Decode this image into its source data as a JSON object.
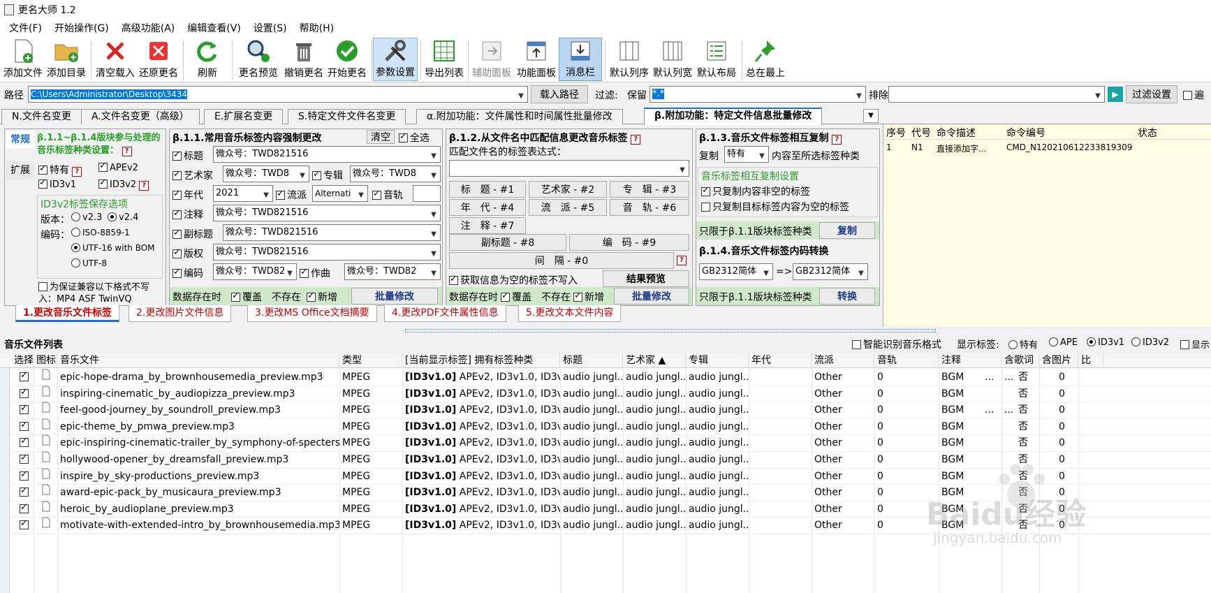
{
  "app": {
    "title": "更名大师 1.2"
  },
  "menu": [
    "文件(F)",
    "开始操作(G)",
    "高级功能(A)",
    "编辑查看(V)",
    "设置(S)",
    "帮助(H)"
  ],
  "toolbar": [
    "添加文件",
    "添加目录",
    "清空载入",
    "还原更名",
    "刷新",
    "更名预览",
    "撤销更名",
    "开始更名",
    "参数设置",
    "导出列表",
    "辅助面板",
    "功能面板",
    "消息栏",
    "默认列序",
    "默认列宽",
    "默认布局",
    "总在最上"
  ],
  "path": {
    "label": "路径",
    "value": "C:\\Users\\Administrator\\Desktop\\3434",
    "load_btn": "载入路径",
    "filter_label": "过滤:",
    "filter_keep": "保留",
    "filter_value": "*.*",
    "exclude_label": "排除",
    "filter_settings": "过滤设置",
    "edge": "遍"
  },
  "tabs": [
    "N.文件名变更",
    "A.文件名变更（高级）",
    "E.扩展名变更",
    "S.特定文件文件名变更",
    "α.附加功能：文件属性和时间属性批量修改",
    "β.附加功能：特定文件信息批量修改"
  ],
  "left": {
    "side_tab1": "常规",
    "side_tab2": "扩展",
    "title": "β.1.1~β.1.4版块参与处理的音乐标签种类设置：",
    "tags": [
      "特有",
      "APEv2",
      "ID3v1",
      "ID3v2"
    ],
    "id3v2_title": "ID3v2标签保存选项",
    "version_label": "版本：",
    "v23": "v2.3",
    "v24": "v2.4",
    "encoding_label": "编码：",
    "enc1": "ISO-8859-1",
    "enc2": "UTF-16 with BOM",
    "enc3": "UTF-8",
    "compat": "为保证兼容以下格式不写入：MP4 ASF TwinVQ"
  },
  "b11": {
    "title": "β.1.1.常用音乐标签内容强制更改",
    "clear": "清空",
    "select_all": "全选",
    "title_lbl": "标题",
    "title_val": "微众号：TWD821516",
    "artist_lbl": "艺术家",
    "artist_val": "微众号：TWD8",
    "album_lbl": "专辑",
    "album_val": "微众号：TWD8",
    "year_lbl": "年代",
    "year_val": "2021",
    "genre_lbl": "流派",
    "genre_val": "Alternati",
    "track_lbl": "音轨",
    "comment_lbl": "注释",
    "comment_val": "微众号：TWD821516",
    "subtitle_lbl": "副标题",
    "subtitle_val": "微众号：TWD821516",
    "copyright_lbl": "版权",
    "copyright_val": "微众号：TWD821516",
    "encoder_lbl": "编码",
    "encoder_val": "微众号：TWD82",
    "composer_lbl": "作曲",
    "composer_val": "微众号：TWD82",
    "exist_lbl": "数据存在时",
    "overwrite": "覆盖",
    "notexist": "不存在",
    "add": "新增",
    "batch": "批量修改"
  },
  "b12": {
    "title": "β.1.2.从文件名中匹配信息更改音乐标签",
    "expr_label": "匹配文件名的标签表达式：",
    "buttons": [
      "标　题 - #1",
      "艺术家 - #2",
      "专　辑 - #3",
      "年　代 - #4",
      "流　派 - #5",
      "音　轨 - #6",
      "注　释 - #7",
      "副标题 - #8",
      "编　码 - #9",
      "间　隔 - #0"
    ],
    "skip_empty": "获取信息为空的标签不写入",
    "preview": "结果预览",
    "exist_lbl": "数据存在时",
    "overwrite": "覆盖",
    "notexist": "不存在",
    "add": "新增",
    "batch": "批量修改"
  },
  "b13": {
    "title": "β.1.3.音乐文件标签相互复制",
    "copy_lbl": "复制",
    "copy_src": "特有",
    "copy_to": "内容至所选标签种类",
    "sub_title": "音乐标签相互复制设置",
    "opt1": "只复制内容非空的标签",
    "opt2": "只复制目标标签内容为空的标签",
    "limit": "只限于β.1.1版块标签种类",
    "copy_btn": "复制"
  },
  "b14": {
    "title": "β.1.4.音乐文件标签内码转换",
    "from": "GB2312简体",
    "arrow": "=>",
    "to": "GB2312简体",
    "limit": "只限于β.1.1版块标签种类",
    "convert_btn": "转换"
  },
  "cmd": {
    "headers": [
      "序号",
      "代号",
      "命令描述",
      "命令编号",
      "状态"
    ],
    "row": [
      "1",
      "N1",
      "直接添加字...",
      "CMD_N120210612233819309",
      ""
    ]
  },
  "bottom_tabs": [
    "1.更改音乐文件标签",
    "2.更改图片文件信息",
    "3.更改MS Office文档摘要",
    "4.更改PDF文件属性信息",
    "5.更改文本文件内容"
  ],
  "list": {
    "title": "音乐文件列表",
    "smart": "智能识别音乐格式",
    "show_label": "显示标签:",
    "show_opts": [
      "特有",
      "APE",
      "ID3v1",
      "ID3v2",
      "显示"
    ],
    "headers": [
      "选择",
      "图标",
      "音乐文件",
      "类型",
      "[当前显示标签] 拥有标签种类",
      "标题",
      "艺术家",
      "专辑",
      "年代",
      "流派",
      "音轨",
      "注释",
      "含歌词",
      "含图片",
      "比"
    ],
    "rows": [
      [
        "epic-hope-drama_by_brownhousemedia_preview.mp3",
        "MPEG",
        "[ID3v1.0]",
        "APEv2, ID3v1.0, ID3v2.3",
        "audio jungl...",
        "audio jungl...",
        "audio jungl...",
        "",
        "Other",
        "0",
        "BGM",
        "...",
        "否",
        "0"
      ],
      [
        "inspiring-cinematic_by_audiopizza_preview.mp3",
        "MPEG",
        "[ID3v1.0]",
        "APEv2, ID3v1.0, ID3v2.3",
        "audio jungl...",
        "audio jungl...",
        "audio jungl...",
        "",
        "Other",
        "0",
        "BGM",
        "",
        "否",
        "0"
      ],
      [
        "feel-good-journey_by_soundroll_preview.mp3",
        "MPEG",
        "[ID3v1.0]",
        "APEv2, ID3v1.0, ID3v2.3",
        "audio jungl...",
        "audio jungl...",
        "audio jungl...",
        "",
        "Other",
        "0",
        "BGM",
        "...",
        "否",
        "0"
      ],
      [
        "epic-theme_by_pmwa_preview.mp3",
        "MPEG",
        "[ID3v1.0]",
        "APEv2, ID3v1.0, ID3v2.3",
        "audio jungl...",
        "audio jungl...",
        "audio jungl...",
        "",
        "Other",
        "0",
        "BGM",
        "",
        "否",
        "0"
      ],
      [
        "epic-inspiring-cinematic-trailer_by_symphony-of-specters....",
        "MPEG",
        "[ID3v1.0]",
        "APEv2, ID3v1.0, ID3v2.3",
        "audio jungl...",
        "audio jungl...",
        "audio jungl...",
        "",
        "Other",
        "0",
        "BGM",
        "",
        "否",
        "0"
      ],
      [
        "hollywood-opener_by_dreamsfall_preview.mp3",
        "MPEG",
        "[ID3v1.0]",
        "APEv2, ID3v1.0, ID3v2.3",
        "audio jungl...",
        "audio jungl...",
        "audio jungl...",
        "",
        "Other",
        "0",
        "BGM",
        "",
        "否",
        "0"
      ],
      [
        "inspire_by_sky-productions_preview.mp3",
        "MPEG",
        "[ID3v1.0]",
        "APEv2, ID3v1.0, ID3v2.3",
        "audio jungl...",
        "audio jungl...",
        "audio jungl...",
        "",
        "Other",
        "0",
        "BGM",
        "",
        "否",
        "0"
      ],
      [
        "award-epic-pack_by_musicaura_preview.mp3",
        "MPEG",
        "[ID3v1.0]",
        "APEv2, ID3v1.0, ID3v2.3",
        "audio jungl...",
        "audio jungl...",
        "audio jungl...",
        "",
        "Other",
        "0",
        "BGM",
        "",
        "否",
        "0"
      ],
      [
        "heroic_by_audioplane_preview.mp3",
        "MPEG",
        "[ID3v1.0]",
        "APEv2, ID3v1.0, ID3v2.3",
        "audio jungl...",
        "audio jungl...",
        "audio jungl...",
        "",
        "Other",
        "0",
        "BGM",
        "",
        "否",
        "0"
      ],
      [
        "motivate-with-extended-intro_by_brownhousemedia.mp3",
        "MPEG",
        "[ID3v1.0]",
        "APEv2, ID3v1.0, ID3v2.3",
        "audio jungl...",
        "audio jungl...",
        "audio jungl...",
        "",
        "Other",
        "0",
        "BGM",
        "",
        "否",
        "0"
      ]
    ]
  },
  "watermark": {
    "brand": "Baidu经验",
    "url": "jingyan.baidu.com"
  },
  "colors": {
    "accent": "#1e6fd0",
    "green": "#2a9d2a",
    "panel_bg": "#fffde4",
    "red": "#cc0000"
  }
}
